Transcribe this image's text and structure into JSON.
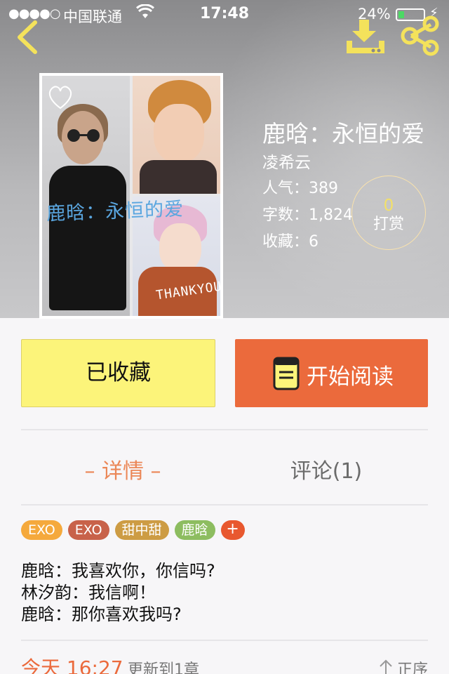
{
  "status_bar": {
    "signal": "●●●●○",
    "carrier": "中国联通",
    "time": "17:48",
    "battery_percent": "24%",
    "battery_level": 0.24,
    "battery_color": "#4cd964"
  },
  "header": {
    "back_icon": "chevron-left-icon",
    "download_icon": "download-icon",
    "share_icon": "share-icon",
    "icon_color": "#f4e25b"
  },
  "cover": {
    "art_title": "鹿晗：永恒的爱",
    "art_caption": "THANKYOU"
  },
  "book": {
    "title": "鹿晗：永恒的爱",
    "author": "凌希云",
    "popularity": "人气：389",
    "word_count": "字数：1,824",
    "favorites": "收藏：6"
  },
  "tip": {
    "count": "0",
    "label": "打赏"
  },
  "actions": {
    "favorite_label": "已收藏",
    "read_label": "开始阅读",
    "favorite_color": "#fcf47a",
    "read_color": "#eb6a3c"
  },
  "tabs": {
    "detail": "– 详情 –",
    "comments": "评论(1)",
    "active_color": "#eb8757"
  },
  "tags": [
    {
      "label": "EXO",
      "color": "#f5a93c"
    },
    {
      "label": "EXO",
      "color": "#c8624a"
    },
    {
      "label": "甜中甜",
      "color": "#cd9c44"
    },
    {
      "label": "鹿晗",
      "color": "#8dbd60"
    }
  ],
  "tag_add": "+",
  "synopsis": "鹿晗：我喜欢你，你信吗?\n林汐韵：我信啊！\n鹿晗：那你喜欢我吗?",
  "update": {
    "time": "今天 16:27",
    "text": "更新到1章",
    "sort_label": "正序"
  }
}
